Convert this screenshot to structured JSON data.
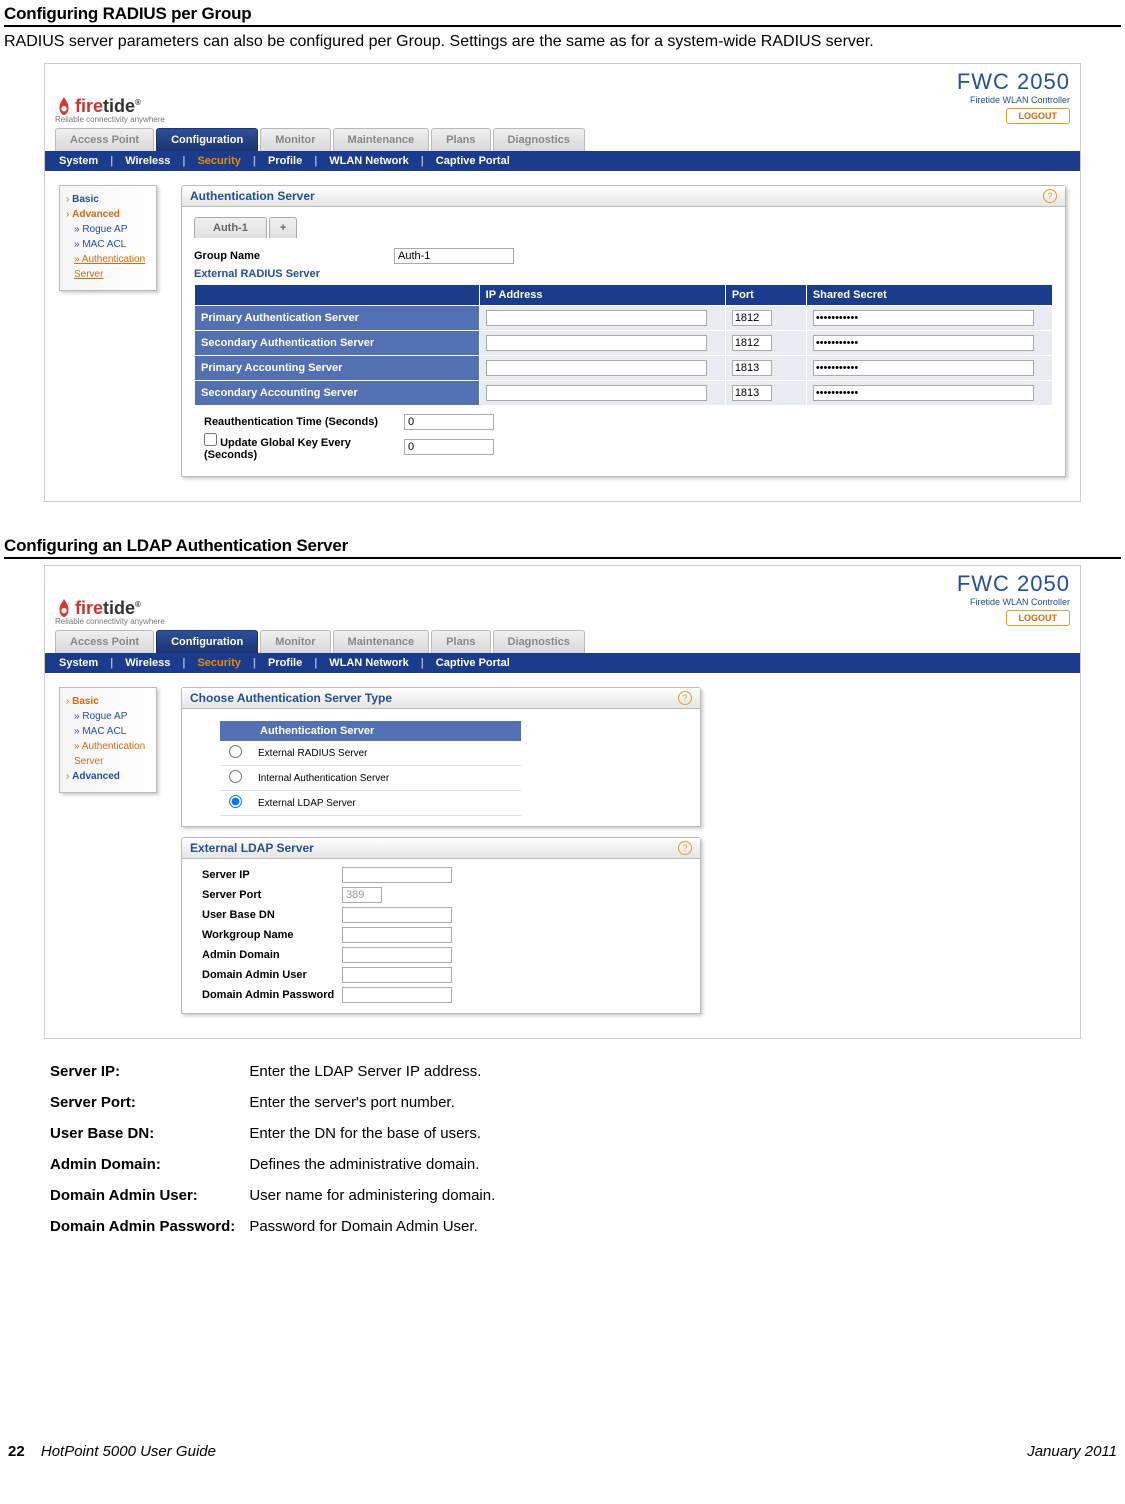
{
  "section1": {
    "title": "Configuring RADIUS per Group",
    "intro": "RADIUS server parameters can also be configured per Group. Settings are the same as for a system-wide RADIUS server."
  },
  "app": {
    "logo_text1": "fire",
    "logo_text2": "tide",
    "logo_tag": "Reliable connectivity anywhere",
    "device_name": "FWC 2050",
    "device_sub": "Firetide WLAN Controller",
    "logout": "LOGOUT",
    "main_tabs": [
      "Access Point",
      "Configuration",
      "Monitor",
      "Maintenance",
      "Plans",
      "Diagnostics"
    ],
    "main_active": "Configuration",
    "sub_tabs": [
      "System",
      "Wireless",
      "Security",
      "Profile",
      "WLAN Network",
      "Captive Portal"
    ],
    "sub_active": "Security"
  },
  "side1": {
    "basic": "Basic",
    "advanced": "Advanced",
    "rogue": "» Rogue AP",
    "mac": "» MAC ACL",
    "auth": "» Authentication Server"
  },
  "panel_auth": {
    "title": "Authentication Server",
    "tab1": "Auth-1",
    "tab2": "+",
    "group_label": "Group Name",
    "group_value": "Auth-1",
    "ext_label": "External RADIUS Server",
    "headers": [
      "",
      "IP Address",
      "Port",
      "Shared Secret"
    ],
    "rows": [
      {
        "name": "Primary Authentication Server",
        "ip": "",
        "port": "1812",
        "secret": "•••••••••••"
      },
      {
        "name": "Secondary Authentication Server",
        "ip": "",
        "port": "1812",
        "secret": "•••••••••••"
      },
      {
        "name": "Primary Accounting Server",
        "ip": "",
        "port": "1813",
        "secret": "•••••••••••"
      },
      {
        "name": "Secondary Accounting Server",
        "ip": "",
        "port": "1813",
        "secret": "•••••••••••"
      }
    ],
    "reauth_label": "Reauthentication Time (Seconds)",
    "reauth_val": "0",
    "update_label": "Update Global Key Every (Seconds)",
    "update_val": "0"
  },
  "section2": {
    "title": "Configuring an LDAP Authentication Server"
  },
  "side2": {
    "basic": "Basic",
    "rogue": "» Rogue AP",
    "mac": "» MAC ACL",
    "auth": "» Authentication Server",
    "advanced": "Advanced"
  },
  "panel_choose": {
    "title": "Choose Authentication Server Type",
    "col": "Authentication Server",
    "opts": [
      "External RADIUS Server",
      "Internal Authentication Server",
      "External LDAP Server"
    ],
    "selected": 2
  },
  "panel_ldap": {
    "title": "External LDAP Server",
    "rows": [
      {
        "label": "Server IP",
        "val": ""
      },
      {
        "label": "Server Port",
        "val": "389",
        "cls": "port"
      },
      {
        "label": "User Base DN",
        "val": ""
      },
      {
        "label": "Workgroup Name",
        "val": ""
      },
      {
        "label": "Admin Domain",
        "val": ""
      },
      {
        "label": "Domain Admin User",
        "val": ""
      },
      {
        "label": "Domain Admin Password",
        "val": ""
      }
    ]
  },
  "descriptions": [
    {
      "k": "Server IP:",
      "v": "Enter the LDAP Server IP address."
    },
    {
      "k": "Server Port:",
      "v": "Enter the server's port number."
    },
    {
      "k": "User Base DN:",
      "v": "Enter the DN for the base of users."
    },
    {
      "k": "Admin Domain:",
      "v": "Defines the administrative domain."
    },
    {
      "k": "Domain Admin User:",
      "v": "User name for administering domain."
    },
    {
      "k": "Domain Admin Password:",
      "v": "Password for Domain Admin User."
    }
  ],
  "footer": {
    "page": "22",
    "guide": "HotPoint 5000 User Guide",
    "date": "January 2011"
  }
}
